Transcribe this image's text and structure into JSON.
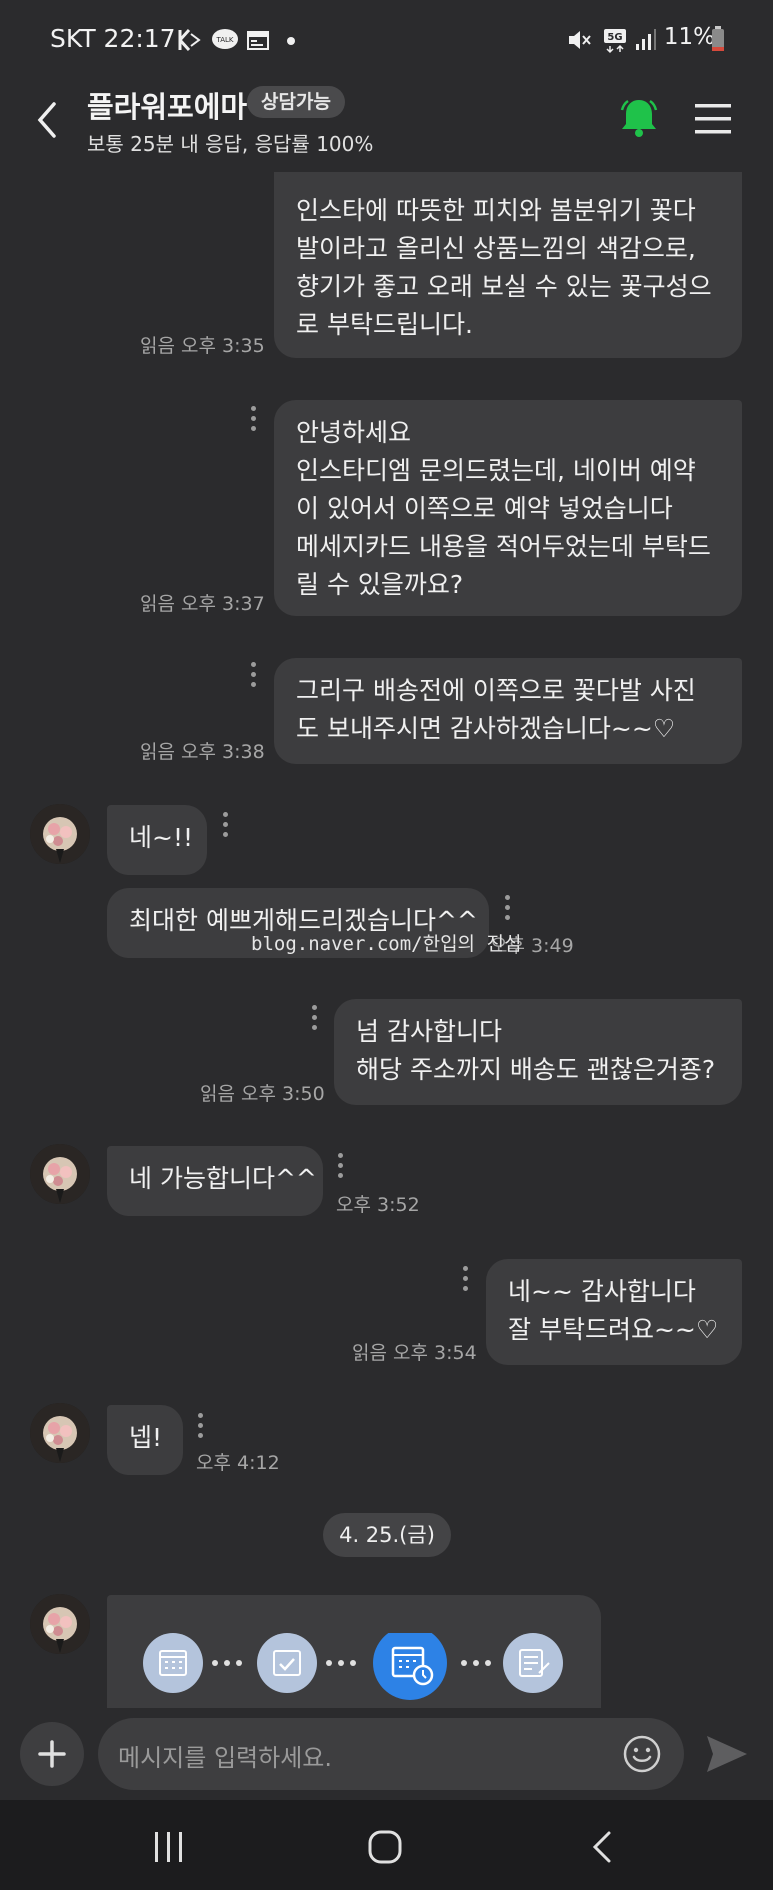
{
  "status_bar": {
    "carrier_time": "SKT 22:17",
    "battery": "11%",
    "network": "5G"
  },
  "header": {
    "title": "플라워포에마",
    "badge": "상담가능",
    "subtitle": "보통 25분 내 응답, 응답률 100%"
  },
  "messages": [
    {
      "lines": [
        "인스타에 따뜻한 피치와 봄분위기 꽃다",
        "발이라고 올리신 상품느낌의 색감으로,",
        "향기가 좋고 오래 보실 수 있는 꽃구성으",
        "로 부탁드립니다."
      ],
      "meta": "읽음 오후 3:35"
    },
    {
      "lines": [
        "안녕하세요",
        "인스타디엠 문의드렸는데, 네이버 예약",
        "이 있어서 이쪽으로 예약 넣었습니다",
        "메세지카드 내용을 적어두었는데 부탁드",
        "릴 수 있을까요?"
      ],
      "meta": "읽음 오후 3:37"
    },
    {
      "lines": [
        "그리구 배송전에 이쪽으로 꽃다발 사진",
        "도 보내주시면 감사하겠습니다~~♡"
      ],
      "meta": "읽음 오후 3:38"
    },
    {
      "lines": [
        "네~!!"
      ]
    },
    {
      "lines": [
        "최대한 예쁘게해드리겠습니다^^"
      ],
      "meta": "오후 3:49"
    },
    {
      "lines": [
        "넘 감사합니다",
        "해당 주소까지 배송도 괜찮은거죵?"
      ],
      "meta": "읽음 오후 3:50"
    },
    {
      "lines": [
        "네 가능합니다^^"
      ],
      "meta": "오후 3:52"
    },
    {
      "lines": [
        "네~~ 감사합니다",
        "잘 부탁드려요~~♡"
      ],
      "meta": "읽음 오후 3:54"
    },
    {
      "lines": [
        "넵!"
      ],
      "meta": "오후 4:12"
    }
  ],
  "date_divider": "4. 25.(금)",
  "watermark": "blog.naver.com/한입의 진심",
  "input": {
    "placeholder": "메시지를 입력하세요."
  },
  "colors": {
    "accent_bell": "#1fc24a",
    "step_active": "#2d82e6",
    "step_inactive": "#b4c4dc",
    "bubble": "#3d3d3f",
    "background": "#2b2b2d"
  },
  "icons": [
    "back-arrow-icon",
    "bell-icon",
    "menu-icon",
    "calendar-icon",
    "check-calendar-icon",
    "calendar-clock-icon",
    "memo-icon",
    "plus-icon",
    "emoji-icon",
    "send-icon",
    "recent-apps-icon",
    "home-icon",
    "nav-back-icon"
  ]
}
